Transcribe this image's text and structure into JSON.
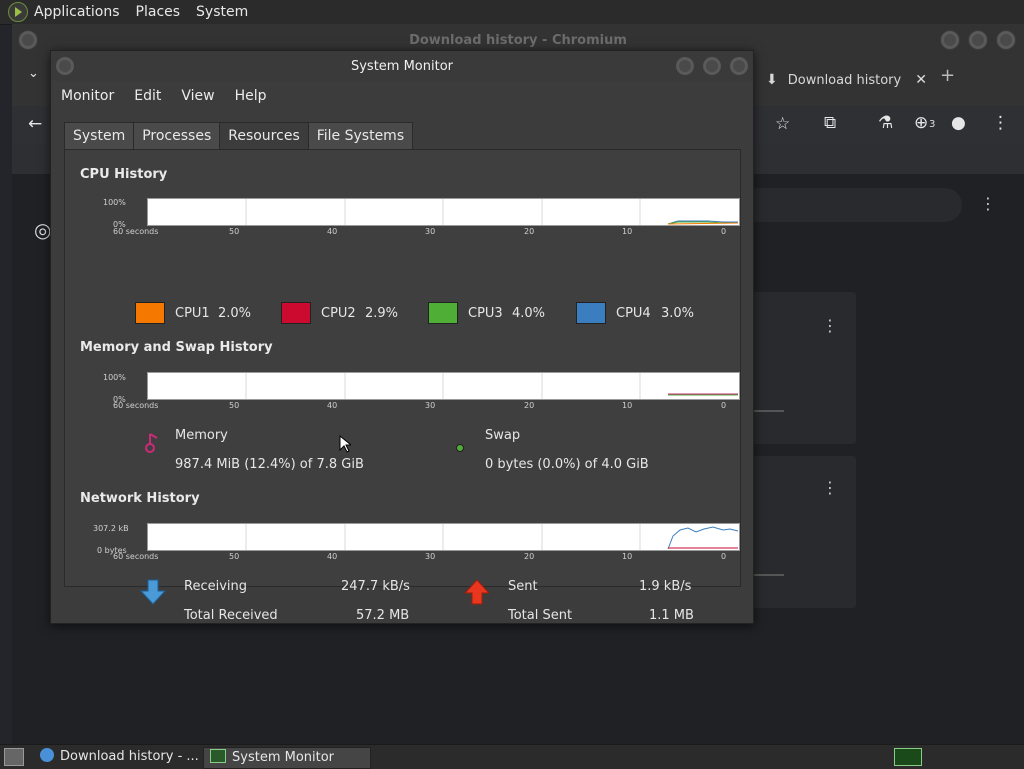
{
  "top_panel": {
    "menus": [
      "Applications",
      "Places",
      "System"
    ]
  },
  "chromium": {
    "window_title": "Download history - Chromium",
    "tab_title": "Download history",
    "downloads_badge": "3"
  },
  "system_monitor": {
    "title": "System Monitor",
    "menus": [
      "Monitor",
      "Edit",
      "View",
      "Help"
    ],
    "tabs": [
      "System",
      "Processes",
      "Resources",
      "File Systems"
    ],
    "active_tab": "Resources",
    "time_ticks": [
      "60 seconds",
      "50",
      "40",
      "30",
      "20",
      "10",
      "0"
    ],
    "cpu": {
      "title": "CPU History",
      "y_top": "100%",
      "y_bottom": "0%",
      "cores": [
        {
          "label": "CPU1",
          "value": "2.0%",
          "color": "#f57900"
        },
        {
          "label": "CPU2",
          "value": "2.9%",
          "color": "#cc0a2f"
        },
        {
          "label": "CPU3",
          "value": "4.0%",
          "color": "#4eae36"
        },
        {
          "label": "CPU4",
          "value": "3.0%",
          "color": "#3a7ebf"
        }
      ]
    },
    "memory": {
      "title": "Memory and Swap History",
      "y_top": "100%",
      "y_bottom": "0%",
      "memory_label": "Memory",
      "memory_value": "987.4 MiB (12.4%) of 7.8 GiB",
      "memory_color": "#cc2a78",
      "swap_label": "Swap",
      "swap_value": "0 bytes (0.0%) of 4.0 GiB",
      "swap_color": "#4eae36"
    },
    "network": {
      "title": "Network History",
      "y_top": "307.2 kB",
      "y_bottom": "0 bytes",
      "receiving_label": "Receiving",
      "receiving_value": "247.7 kB/s",
      "total_received_label": "Total Received",
      "total_received_value": "57.2 MB",
      "sent_label": "Sent",
      "sent_value": "1.9 kB/s",
      "total_sent_label": "Total Sent",
      "total_sent_value": "1.1 MB"
    }
  },
  "taskbar": {
    "items": [
      "Download history - ...",
      "System Monitor"
    ]
  }
}
